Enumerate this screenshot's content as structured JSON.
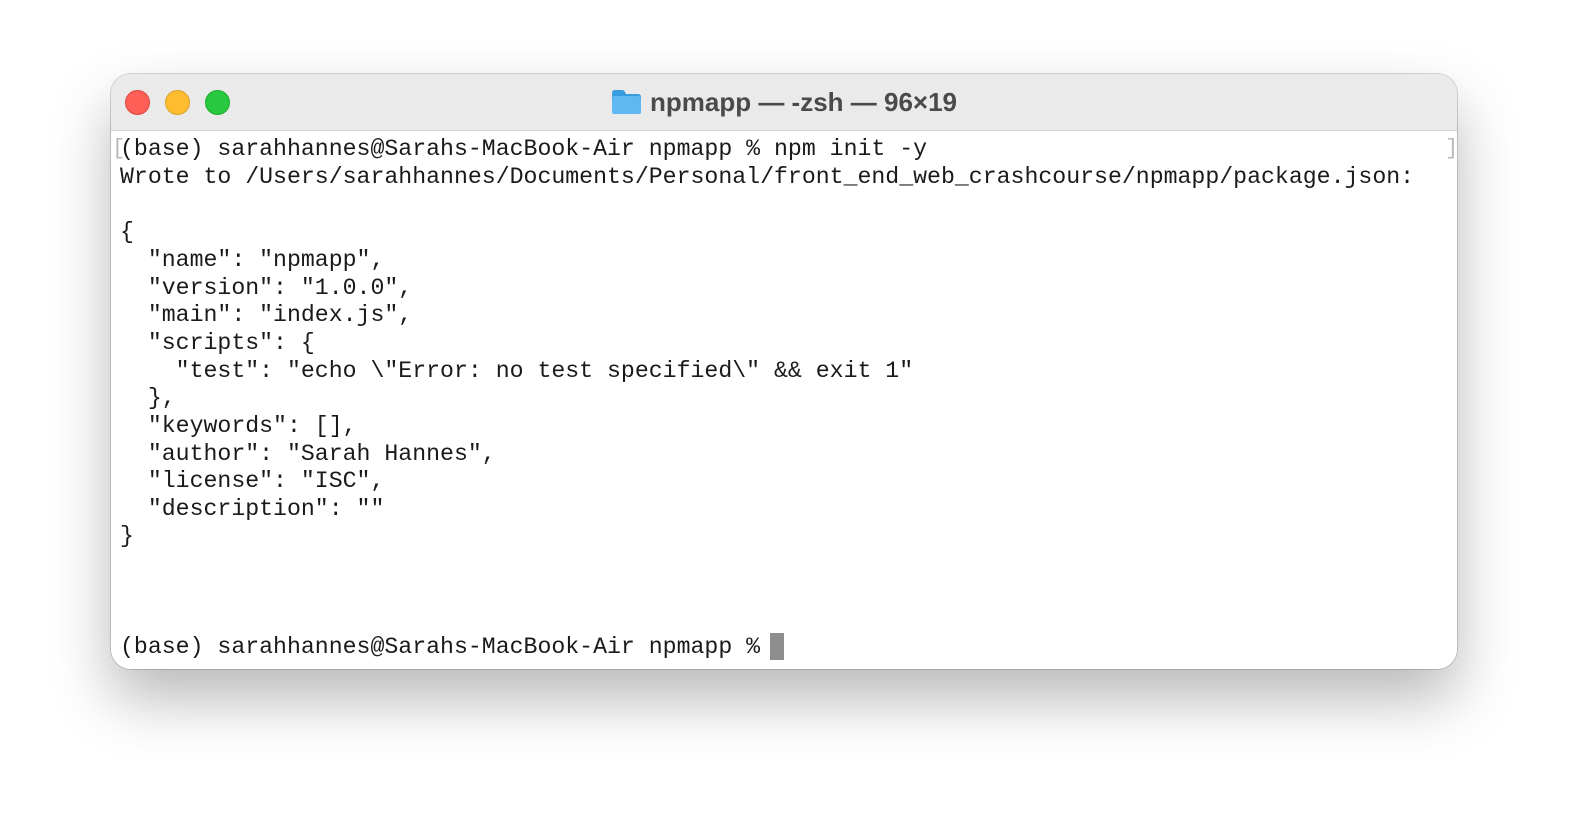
{
  "window": {
    "title": "npmapp — -zsh — 96×19",
    "folder_icon": "folder-icon"
  },
  "traffic_lights": {
    "close": "#fe5f57",
    "minimize": "#febc2e",
    "zoom": "#28c840"
  },
  "terminal": {
    "lines": [
      "(base) sarahhannes@Sarahs-MacBook-Air npmapp % npm init -y",
      "Wrote to /Users/sarahhannes/Documents/Personal/front_end_web_crashcourse/npmapp/package.json:",
      "",
      "{",
      "  \"name\": \"npmapp\",",
      "  \"version\": \"1.0.0\",",
      "  \"main\": \"index.js\",",
      "  \"scripts\": {",
      "    \"test\": \"echo \\\"Error: no test specified\\\" && exit 1\"",
      "  },",
      "  \"keywords\": [],",
      "  \"author\": \"Sarah Hannes\",",
      "  \"license\": \"ISC\",",
      "  \"description\": \"\"",
      "}"
    ],
    "prompt": "(base) sarahhannes@Sarahs-MacBook-Air npmapp % ",
    "cursor_color": "#8e8e8e"
  }
}
